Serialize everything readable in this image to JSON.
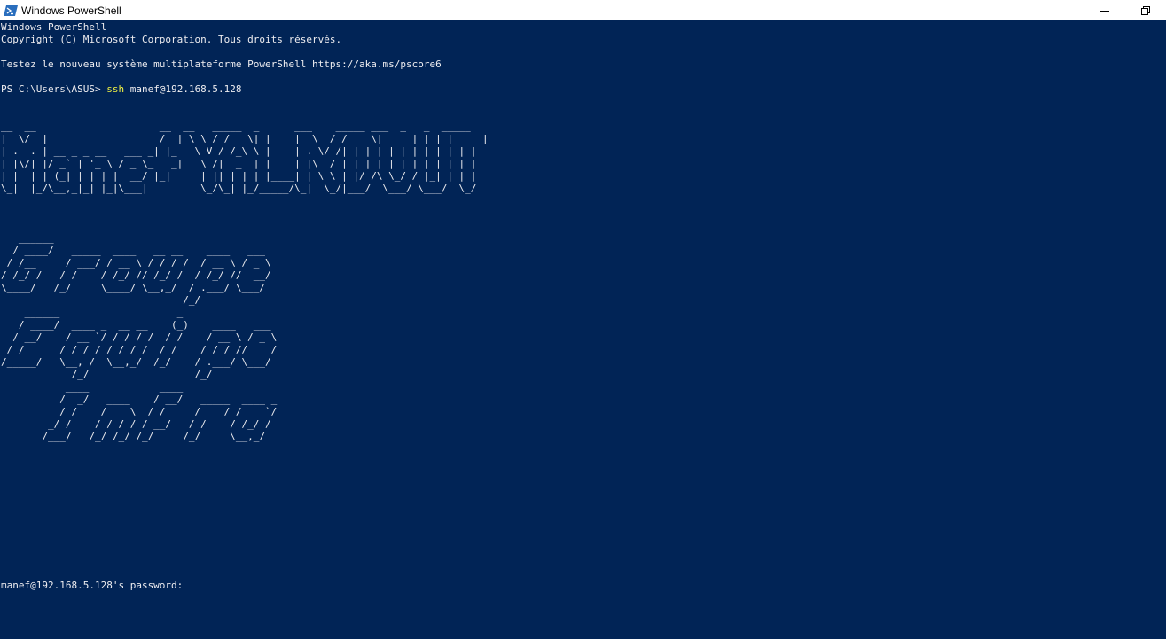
{
  "window": {
    "title": "Windows PowerShell"
  },
  "icons": {
    "app": "powershell-icon",
    "minimize": "minimize-icon",
    "restore": "restore-icon"
  },
  "colors": {
    "console_bg": "#012456",
    "console_fg": "#eeedf0",
    "command_fg": "#f5f543",
    "titlebar_bg": "#ffffff"
  },
  "console": {
    "header_line1": "Windows PowerShell",
    "header_line2": "Copyright (C) Microsoft Corporation. Tous droits réservés.",
    "header_line3": "Testez le nouveau système multiplateforme PowerShell https://aka.ms/pscore6",
    "prompt": "PS C:\\Users\\ASUS> ",
    "command": "ssh",
    "command_args": " manef@192.168.5.128",
    "banner_art": [
      "__  __                     __  __   _____  _      ___    _____ ___  _   _  _____ ",
      "|  \\/  |                   / _| \\ \\ / / _ \\| |    |  \\  / /  _ \\|  _  | | | |_   _|",
      "| .  . | __ _ _ __   ___ _| |_   \\ V / /_\\ \\ |    | . \\/ /| | | | | | | | | | | |  ",
      "| |\\/| |/ _` | '_ \\ / _ \\_   _|   \\ /|  _  | |    | |\\  / | | | | | | | | | | | |  ",
      "| |  | | (_| | | | |  __/ |_|     | || | | | |____| | \\ \\ | |/ /\\ \\_/ / |_| | | |  ",
      "\\_|  |_/\\__,_|_| |_|\\___|         \\_/\\_| |_/_____/\\_|  \\_/|___/  \\___/ \\___/  \\_/  "
    ],
    "word1_art": [
      "   ______                                   ",
      "  / ____/   _____  ____   __ __    ____   ___ ",
      " / /__     / ___/ / __ \\ / / / /  / __ \\ / _ \\",
      "/ /_/ /   / /    / /_/ // /_/ /  / /_/ //  __/",
      "\\____/   /_/     \\____/ \\__,_/  / .___/ \\___/ ",
      "                               /_/            "
    ],
    "word2_art": [
      "    ______                    _               ",
      "   / ____/  ____ _  __ __    (_)    ____   ___ ",
      "  / __/    / __ `/ / / / /  / /    / __ \\ / _ \\",
      " / /___   / /_/ / / /_/ /  / /    / /_/ //  __/",
      "/_____/   \\__, /  \\__,_/  /_/    / .___/ \\___/ ",
      "            /_/                  /_/            "
    ],
    "word3_art": [
      "           ____            ____                  ",
      "          /  _/   ____    / __/   _____  ____ _  ",
      "          / /    / __ \\  / /_    / ___/ / __ `/  ",
      "        _/ /    / / / / / __/   / /    / /_/ /   ",
      "       /___/   /_/ /_/ /_/     /_/     \\__,_/    "
    ],
    "password_prompt": "manef@192.168.5.128's password:"
  }
}
